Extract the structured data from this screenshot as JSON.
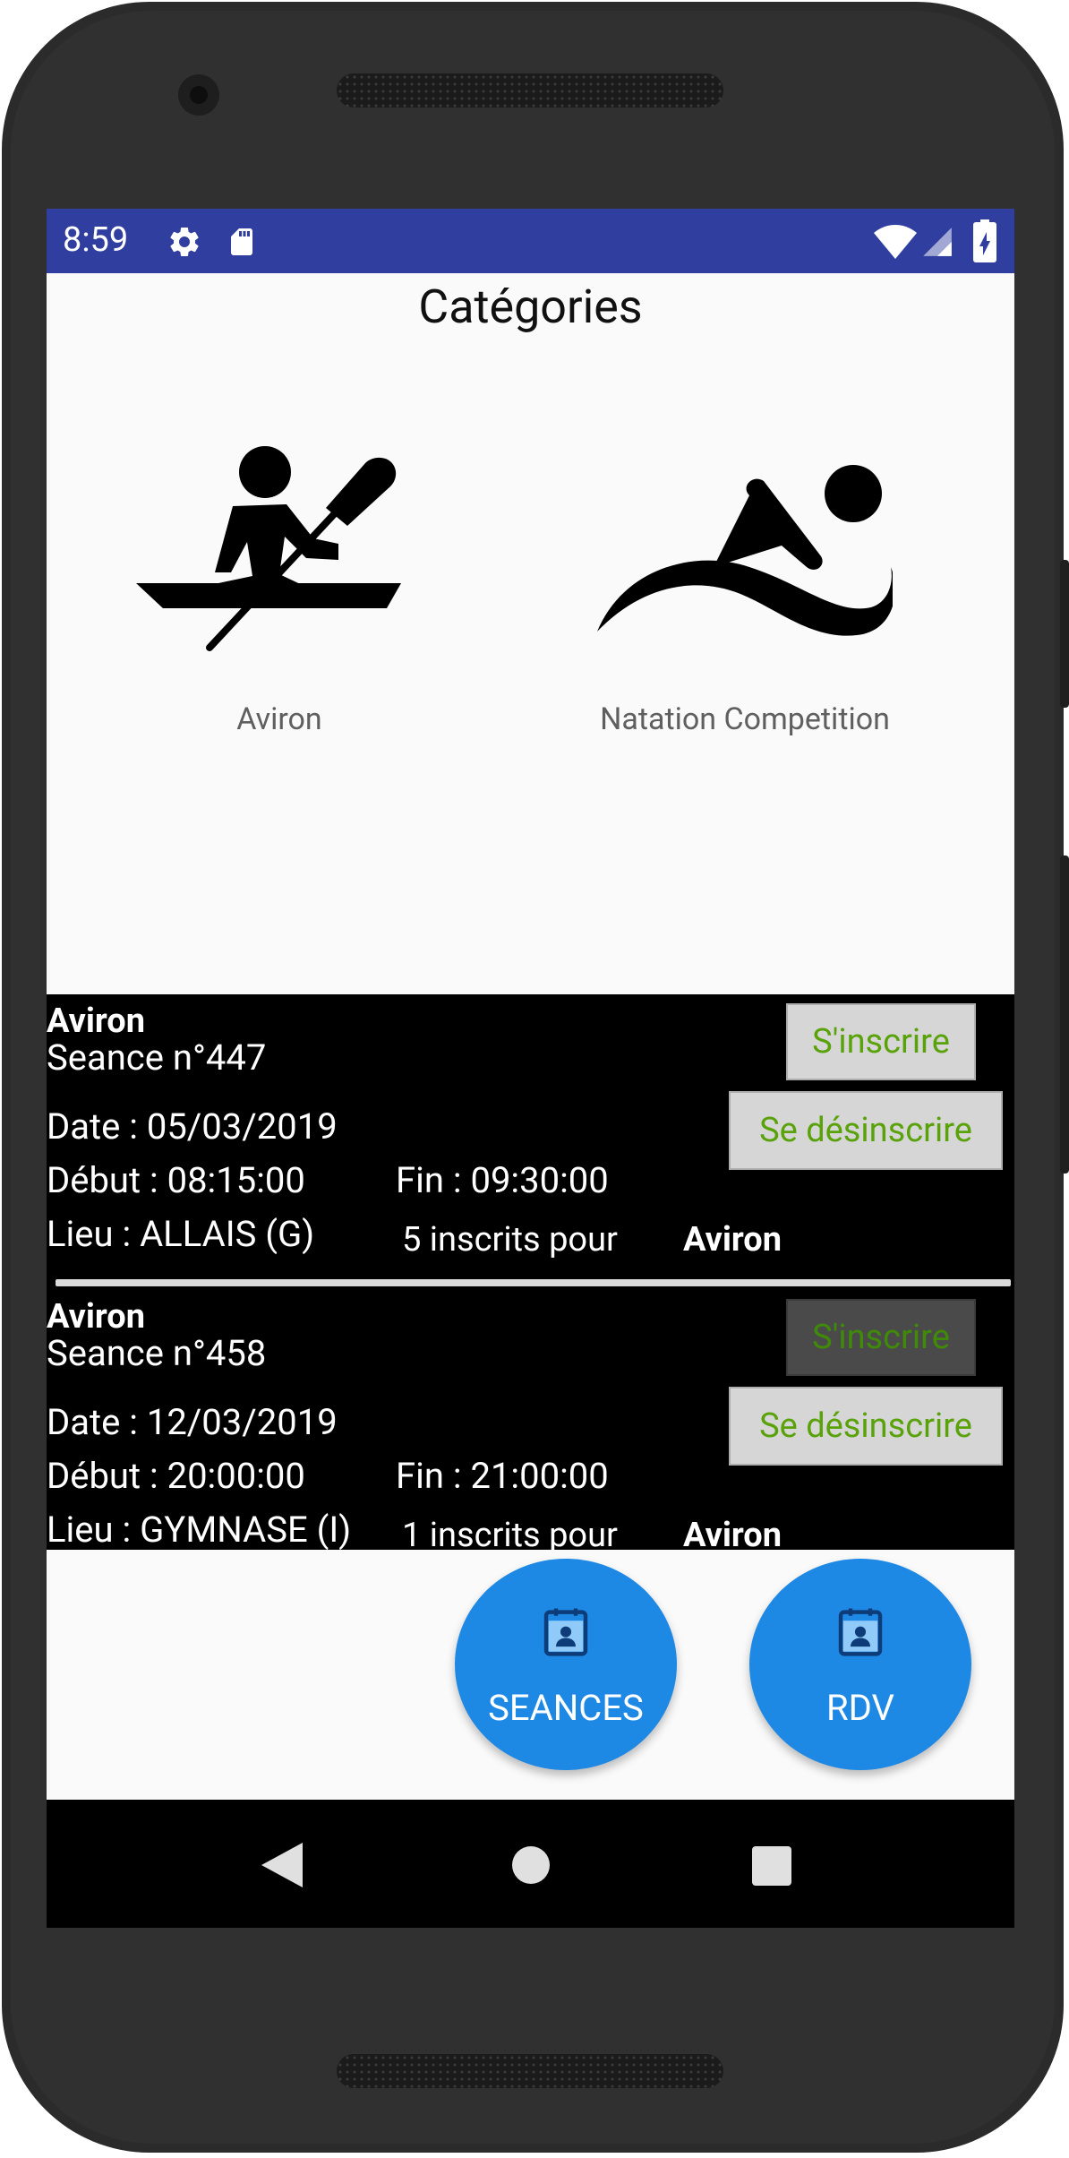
{
  "status_bar": {
    "time": "8:59",
    "icons": [
      "gear-icon",
      "sd-card-icon",
      "wifi-icon",
      "signal-icon",
      "battery-icon"
    ],
    "background": "#303f9f"
  },
  "header": {
    "title": "Catégories"
  },
  "categories": [
    {
      "label": "Aviron",
      "icon": "rowing-icon"
    },
    {
      "label": "Natation Competition",
      "icon": "swimming-icon"
    }
  ],
  "sessions": [
    {
      "category": "Aviron",
      "seance": "Seance n°447",
      "date": "Date : 05/03/2019",
      "debut": "Début : 08:15:00",
      "fin": "Fin : 09:30:00",
      "lieu": "Lieu : ALLAIS (G)",
      "count_text": "5 inscrits pour",
      "count_category": "Aviron",
      "subscribe_label": "S'inscrire",
      "subscribe_enabled": true,
      "unsubscribe_label": "Se désinscrire"
    },
    {
      "category": "Aviron",
      "seance": "Seance n°458",
      "date": "Date : 12/03/2019",
      "debut": "Début : 20:00:00",
      "fin": "Fin : 21:00:00",
      "lieu": "Lieu : GYMNASE (I)",
      "count_text": "1 inscrits pour",
      "count_category": "Aviron",
      "subscribe_label": "S'inscrire",
      "subscribe_enabled": false,
      "unsubscribe_label": "Se désinscrire"
    }
  ],
  "fabs": [
    {
      "label": "SEANCES",
      "icon": "calendar-contact-icon"
    },
    {
      "label": "RDV",
      "icon": "calendar-contact-icon"
    }
  ],
  "nav_bar": {
    "buttons": [
      "back-icon",
      "home-icon",
      "recents-icon"
    ]
  },
  "colors": {
    "accent": "#1e88e5",
    "button_text": "#5aa20a",
    "list_background": "#000000"
  }
}
